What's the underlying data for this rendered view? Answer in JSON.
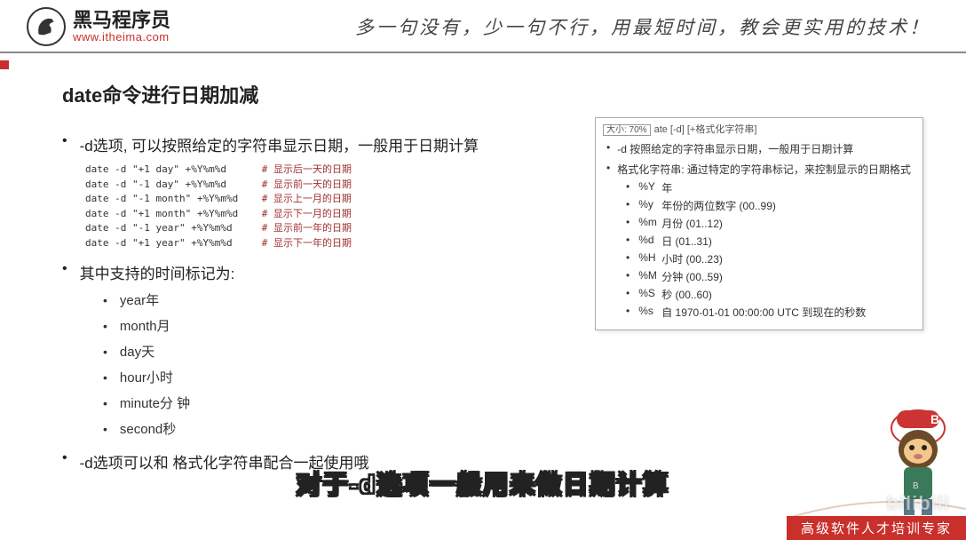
{
  "header": {
    "logo_cn": "黑马程序员",
    "logo_url": "www.itheima.com",
    "slogan": "多一句没有，少一句不行，用最短时间，教会更实用的技术！"
  },
  "title": "date命令进行日期加减",
  "bullets": {
    "b1": "-d选项, 可以按照给定的字符串显示日期，一般用于日期计算",
    "b2": "其中支持的时间标记为:",
    "b3": "-d选项可以和 格式化字符串配合一起使用哦"
  },
  "code": [
    {
      "cmd": "date -d \"+1 day\" +%Y%m%d",
      "comment": "# 显示后一天的日期"
    },
    {
      "cmd": "date -d \"-1 day\" +%Y%m%d",
      "comment": "# 显示前一天的日期"
    },
    {
      "cmd": "date -d \"-1 month\" +%Y%m%d",
      "comment": "# 显示上一月的日期"
    },
    {
      "cmd": "date -d \"+1 month\" +%Y%m%d",
      "comment": "# 显示下一月的日期"
    },
    {
      "cmd": "date -d \"-1 year\" +%Y%m%d",
      "comment": "# 显示前一年的日期"
    },
    {
      "cmd": "date -d \"+1 year\" +%Y%m%d",
      "comment": "# 显示下一年的日期"
    }
  ],
  "units": [
    "year年",
    "month月",
    "day天",
    "hour小时",
    "minute分 钟",
    "second秒"
  ],
  "ref": {
    "zoom": "大小: 70%",
    "syntax": "ate [-d] [+格式化字符串]",
    "l1": "-d 按照给定的字符串显示日期，一般用于日期计算",
    "l2": "格式化字符串: 通过特定的字符串标记，来控制显示的日期格式",
    "fmts": [
      {
        "k": "%Y",
        "v": "年"
      },
      {
        "k": "%y",
        "v": "年份的两位数字 (00..99)"
      },
      {
        "k": "%m",
        "v": "月份 (01..12)"
      },
      {
        "k": "%d",
        "v": "日 (01..31)"
      },
      {
        "k": "%H",
        "v": "小时 (00..23)"
      },
      {
        "k": "%M",
        "v": "分钟 (00..59)"
      },
      {
        "k": "%S",
        "v": "秒 (00..60)"
      },
      {
        "k": "%s",
        "v": "自 1970-01-01 00:00:00 UTC 到现在的秒数"
      }
    ]
  },
  "subtitle": "对于-d选项一般用来做日期计算",
  "footer": "高级软件人才培训专家",
  "watermark": "bilibili",
  "mascot_letter": "B"
}
